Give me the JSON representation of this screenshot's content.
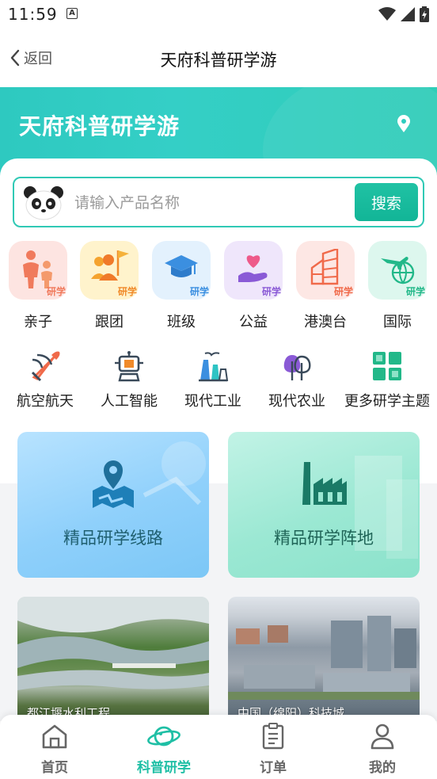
{
  "status_bar": {
    "time": "11:59",
    "notif_letter": "A"
  },
  "nav": {
    "back_label": "返回",
    "title": "天府科普研学游"
  },
  "hero": {
    "title": "天府科普研学游"
  },
  "search": {
    "placeholder": "请输入产品名称",
    "button_label": "搜索"
  },
  "categories": [
    {
      "label": "亲子",
      "tag": "研学",
      "icon": "family-icon",
      "tile_color": "#fde4e1",
      "tag_color": "#f07a5c"
    },
    {
      "label": "跟团",
      "tag": "研学",
      "icon": "group-flag-icon",
      "tile_color": "#fff3cc",
      "tag_color": "#f08a2a"
    },
    {
      "label": "班级",
      "tag": "研学",
      "icon": "graduation-cap-icon",
      "tile_color": "#e3f1fd",
      "tag_color": "#3b8fe0"
    },
    {
      "label": "公益",
      "tag": "研学",
      "icon": "heart-hand-icon",
      "tile_color": "#efe6fb",
      "tag_color": "#8a5ad6"
    },
    {
      "label": "港澳台",
      "tag": "研学",
      "icon": "building-icon",
      "tile_color": "#fde7e4",
      "tag_color": "#f06a4a"
    },
    {
      "label": "国际",
      "tag": "研学",
      "icon": "plane-globe-icon",
      "tile_color": "#ddf7ee",
      "tag_color": "#22b889"
    }
  ],
  "topics": [
    {
      "label": "航空航天",
      "icon": "rocket-icon"
    },
    {
      "label": "人工智能",
      "icon": "robot-icon"
    },
    {
      "label": "现代工业",
      "icon": "factory-icon"
    },
    {
      "label": "现代农业",
      "icon": "tree-icon"
    },
    {
      "label": "更多研学主题",
      "icon": "grid-icon"
    }
  ],
  "features": [
    {
      "label": "精品研学线路",
      "icon": "map-route-icon"
    },
    {
      "label": "精品研学阵地",
      "icon": "industrial-base-icon"
    }
  ],
  "photos": [
    {
      "caption": "都江堰水利工程"
    },
    {
      "caption": "中国（绵阳）科技城"
    }
  ],
  "tabs": [
    {
      "label": "首页",
      "icon": "home-icon",
      "active": false
    },
    {
      "label": "科普研学",
      "icon": "planet-icon",
      "active": true
    },
    {
      "label": "订单",
      "icon": "clipboard-icon",
      "active": false
    },
    {
      "label": "我的",
      "icon": "user-icon",
      "active": false
    }
  ],
  "colors": {
    "accent": "#1fbfa5",
    "hero": "#30cdbf"
  }
}
